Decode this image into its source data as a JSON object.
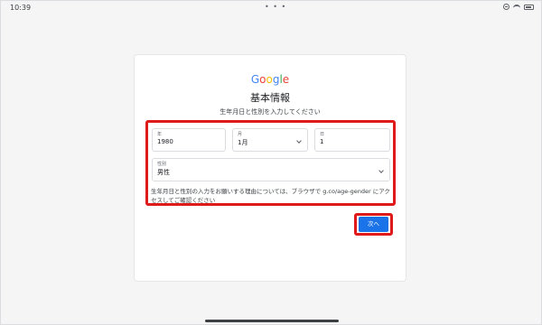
{
  "status_bar": {
    "time": "10:39",
    "dots": "• • •"
  },
  "card": {
    "logo": {
      "letters": [
        "G",
        "o",
        "o",
        "g",
        "l",
        "e"
      ],
      "colors": [
        "#4285f4",
        "#ea4335",
        "#fbbc05",
        "#4285f4",
        "#34a853",
        "#ea4335"
      ]
    },
    "title": "基本情報",
    "subtitle": "生年月日と性別を入力してください",
    "form": {
      "year": {
        "label": "年",
        "value": "1980"
      },
      "month": {
        "label": "月",
        "value": "1月"
      },
      "day": {
        "label": "日",
        "value": "1"
      },
      "gender": {
        "label": "性別",
        "value": "男性"
      }
    },
    "note": "生年月日と性別の入力をお願いする理由については、ブラウザで g.co/age-gender にアクセスしてご確認ください",
    "next_label": "次へ"
  },
  "colors": {
    "highlight": "#e0191a",
    "primary": "#1a73e8"
  },
  "icons": [
    "do-not-disturb-icon",
    "wifi-icon",
    "battery-icon",
    "chevron-down-icon"
  ]
}
